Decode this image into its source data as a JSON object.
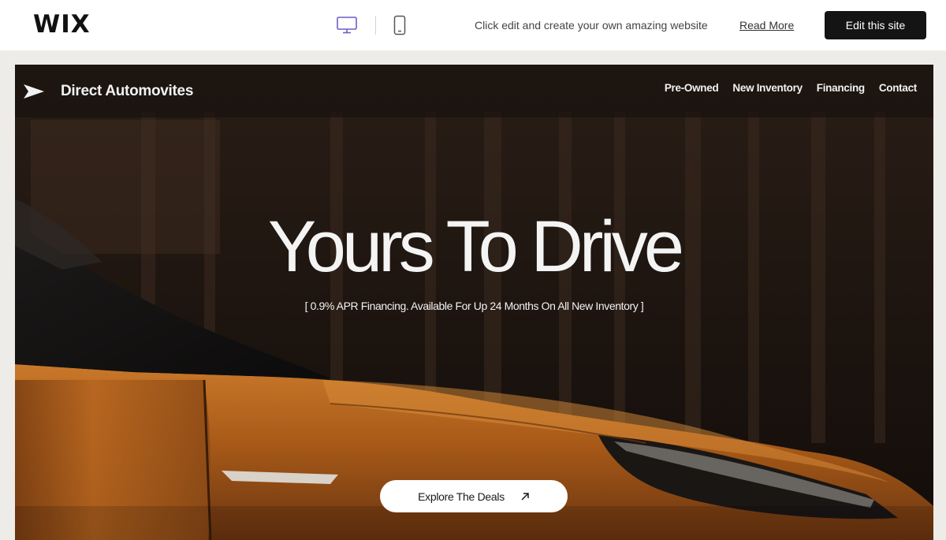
{
  "wix_bar": {
    "logo": "WIX",
    "device_desktop_icon": "desktop-monitor-icon",
    "device_mobile_icon": "mobile-phone-icon",
    "promo_text": "Click edit and create your own amazing website",
    "read_more_label": "Read More",
    "edit_button_label": "Edit this site"
  },
  "site": {
    "brand": {
      "icon": "paper-plane-icon",
      "name": "Direct Automovites"
    },
    "nav": [
      {
        "label": "Pre-Owned"
      },
      {
        "label": "New Inventory"
      },
      {
        "label": "Financing"
      },
      {
        "label": "Contact"
      }
    ],
    "hero": {
      "headline": "Yours To Drive",
      "subline": "[  0.9% APR Financing. Available For Up 24 Months On All New Inventory  ]",
      "cta_label": "Explore The Deals",
      "cta_icon": "arrow-up-right-icon"
    }
  },
  "colors": {
    "wix_accent": "#6b5fc7",
    "car_orange": "#b8621a",
    "edit_button_bg": "#141414"
  }
}
